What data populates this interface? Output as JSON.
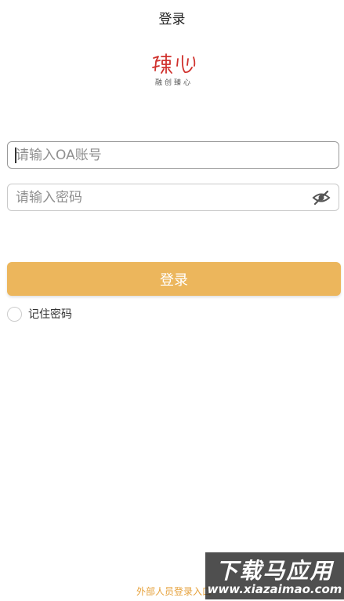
{
  "header": {
    "title": "登录"
  },
  "logo": {
    "mark_text": "臻心",
    "tagline": "融创臻心",
    "brand_color": "#d0312d"
  },
  "form": {
    "account": {
      "placeholder": "请输入OA账号",
      "value": ""
    },
    "password": {
      "placeholder": "请输入密码",
      "value": "",
      "toggle_icon": "eye-slash-icon"
    },
    "login_button_label": "登录",
    "remember_label": "记住密码",
    "remember_checked": false
  },
  "footer": {
    "external_login_label": "外部人员登录入口"
  },
  "watermark": {
    "title": "下载马应用",
    "url": "www.xiazaimao.com"
  },
  "colors": {
    "accent": "#ecb65c",
    "link": "#e6a23c",
    "text": "#222222"
  }
}
